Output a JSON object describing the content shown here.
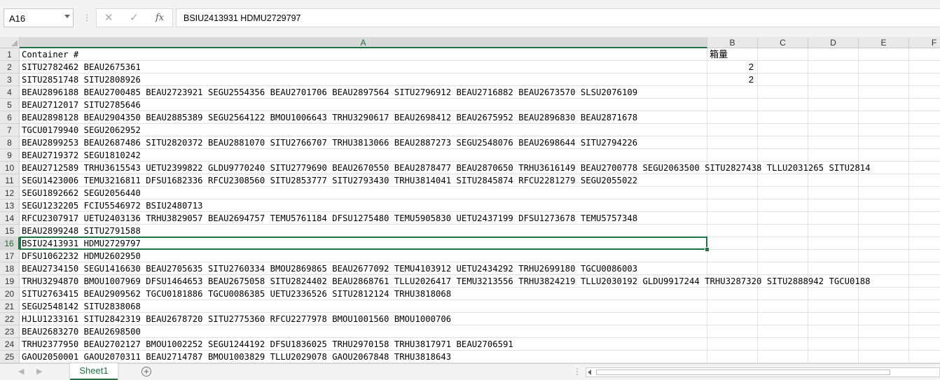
{
  "formula_bar": {
    "name_box": "A16",
    "separator": "⋮",
    "cancel_glyph": "✕",
    "enter_glyph": "✓",
    "fx_label": "fx",
    "content": "BSIU2413931 HDMU2729797"
  },
  "columns": [
    "A",
    "B",
    "C",
    "D",
    "E",
    "F"
  ],
  "rows": [
    {
      "n": "1",
      "a": "Container #",
      "b": "箱量"
    },
    {
      "n": "2",
      "a": "SITU2782462 BEAU2675361",
      "b": "2"
    },
    {
      "n": "3",
      "a": "SITU2851748 SITU2808926",
      "b": "2"
    },
    {
      "n": "4",
      "a": "BEAU2896188 BEAU2700485 BEAU2723921 SEGU2554356 BEAU2701706 BEAU2897564 SITU2796912 BEAU2716882 BEAU2673570 SLSU2076109",
      "b": ""
    },
    {
      "n": "5",
      "a": "BEAU2712017 SITU2785646",
      "b": ""
    },
    {
      "n": "6",
      "a": "BEAU2898128 BEAU2904350 BEAU2885389 SEGU2564122 BMOU1006643 TRHU3290617 BEAU2698412 BEAU2675952 BEAU2896830 BEAU2871678",
      "b": ""
    },
    {
      "n": "7",
      "a": "TGCU0179940 SEGU2062952",
      "b": ""
    },
    {
      "n": "8",
      "a": "BEAU2899253 BEAU2687486 SITU2820372 BEAU2881070 SITU2766707 TRHU3813066 BEAU2887273 SEGU2548076 BEAU2698644 SITU2794226",
      "b": ""
    },
    {
      "n": "9",
      "a": "BEAU2719372 SEGU1810242",
      "b": ""
    },
    {
      "n": "10",
      "a": "BEAU2712589 TRHU3615543 UETU2399822 GLDU9770240 SITU2779690 BEAU2670550 BEAU2878477 BEAU2870650 TRHU3616149 BEAU2700778 SEGU2063500 SITU2827438 TLLU2031265 SITU2814",
      "b": ""
    },
    {
      "n": "11",
      "a": "SEGU1423006 TEMU3216811 DFSU1682336 RFCU2308560 SITU2853777 SITU2793430 TRHU3814041 SITU2845874 RFCU2281279 SEGU2055022",
      "b": ""
    },
    {
      "n": "12",
      "a": "SEGU1892662 SEGU2056440",
      "b": ""
    },
    {
      "n": "13",
      "a": "SEGU1232205 FCIU5546972 BSIU2480713",
      "b": ""
    },
    {
      "n": "14",
      "a": "RFCU2307917 UETU2403136 TRHU3829057 BEAU2694757 TEMU5761184 DFSU1275480 TEMU5905830 UETU2437199 DFSU1273678 TEMU5757348",
      "b": ""
    },
    {
      "n": "15",
      "a": "BEAU2899248 SITU2791588",
      "b": ""
    },
    {
      "n": "16",
      "a": "BSIU2413931 HDMU2729797",
      "b": ""
    },
    {
      "n": "17",
      "a": "DFSU1062232 HDMU2602950",
      "b": ""
    },
    {
      "n": "18",
      "a": "BEAU2734150 SEGU1416630 BEAU2705635 SITU2760334 BMOU2869865 BEAU2677092 TEMU4103912 UETU2434292 TRHU2699180 TGCU0086003",
      "b": ""
    },
    {
      "n": "19",
      "a": "TRHU3294870 BMOU1007969 DFSU1464653 BEAU2675058 SITU2824402 BEAU2868761 TLLU2026417 TEMU3213556 TRHU3824219 TLLU2030192 GLDU9917244 TRHU3287320 SITU2888942 TGCU0188",
      "b": ""
    },
    {
      "n": "20",
      "a": "SITU2763415 BEAU2909562 TGCU0181886 TGCU0086385 UETU2336526 SITU2812124 TRHU3818068",
      "b": ""
    },
    {
      "n": "21",
      "a": "SEGU2548142 SITU2838068",
      "b": ""
    },
    {
      "n": "22",
      "a": "HJLU1233161 SITU2842319 BEAU2678720 SITU2775360 RFCU2277978 BMOU1001560 BMOU1000706",
      "b": ""
    },
    {
      "n": "23",
      "a": "BEAU2683270 BEAU2698500",
      "b": ""
    },
    {
      "n": "24",
      "a": "TRHU2377950 BEAU2702127 BMOU1002252 SEGU1244192 DFSU1836025 TRHU2970158 TRHU3817971 BEAU2706591",
      "b": ""
    },
    {
      "n": "25",
      "a": "GAOU2050001 GAOU2070311 BEAU2714787 BMOU1003829 TLLU2029078 GAOU2067848 TRHU3818643",
      "b": ""
    }
  ],
  "sheet_tabs": [
    "Sheet1"
  ],
  "add_sheet_glyph": "+",
  "tab_nav": {
    "prev": "◀",
    "next": "▶"
  },
  "split_dots": "⋮",
  "accent_color": "#217346"
}
